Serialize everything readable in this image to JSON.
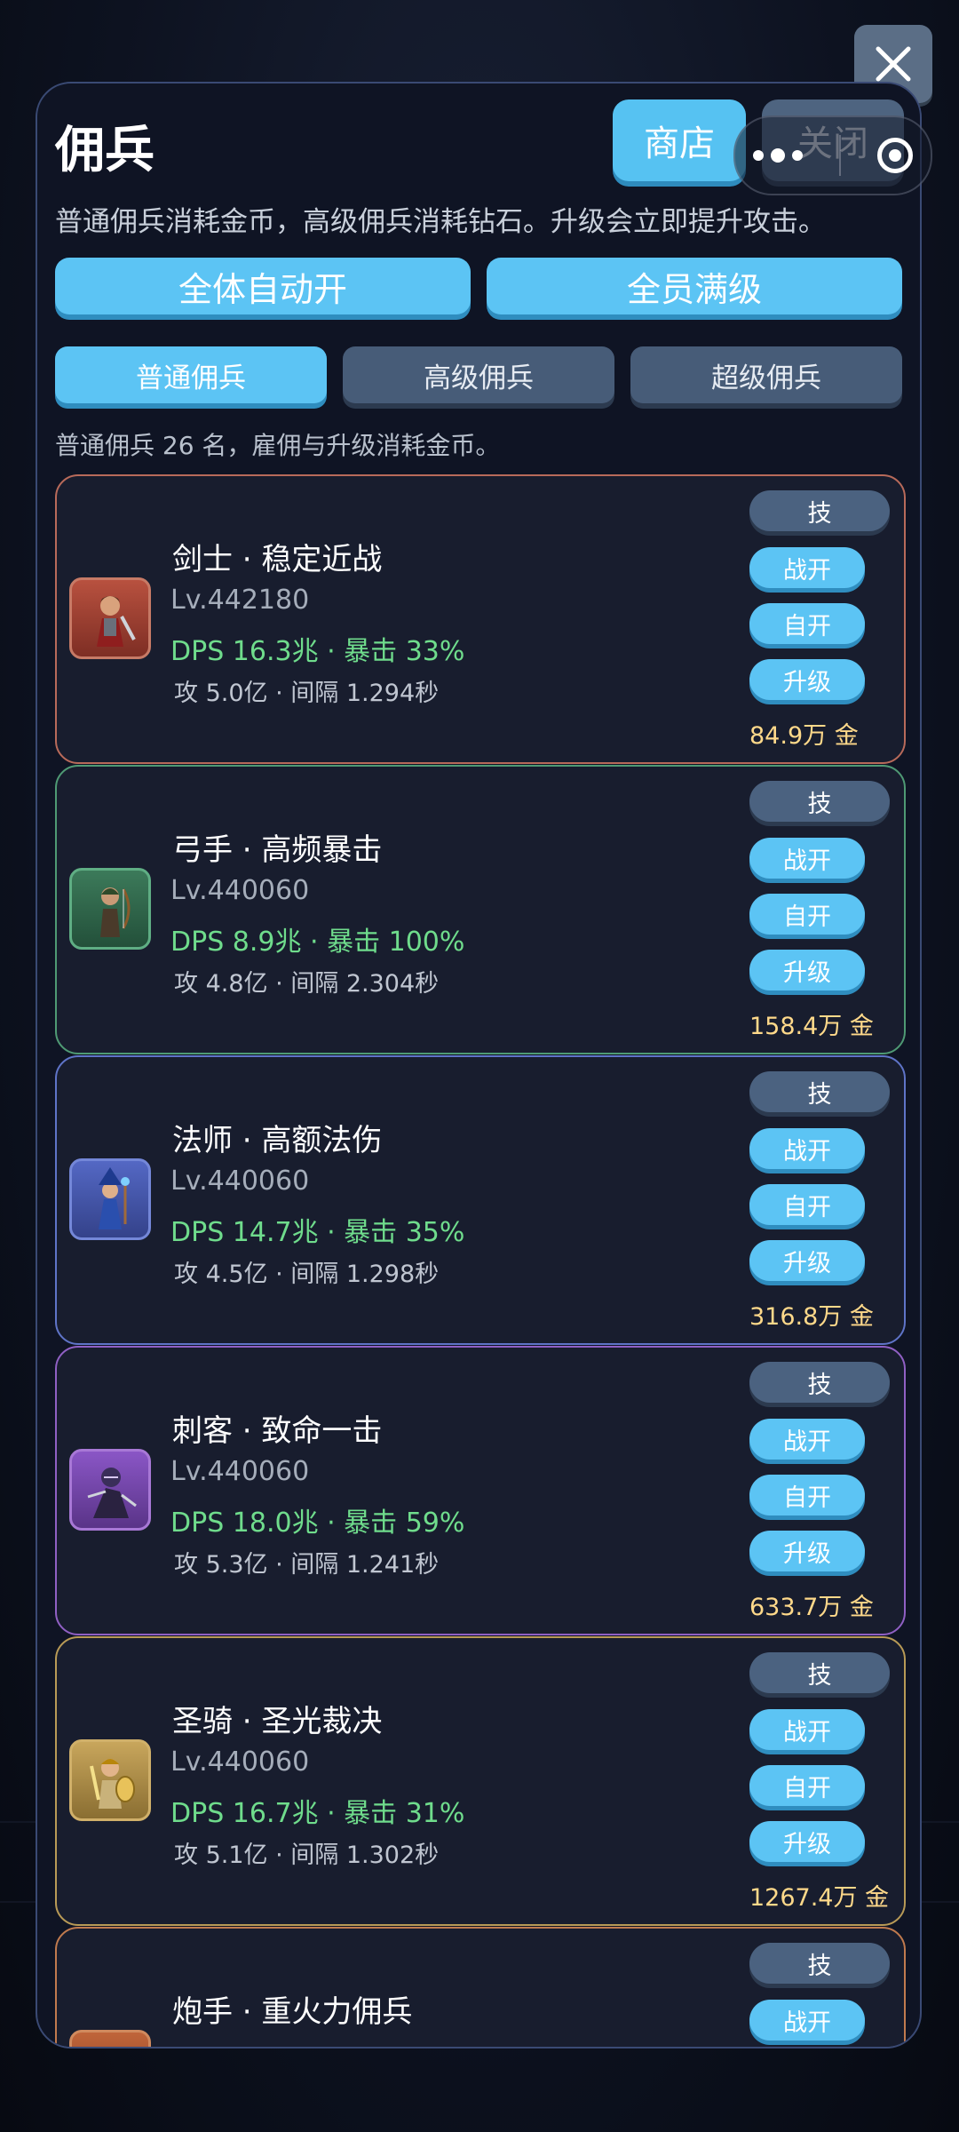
{
  "top": {
    "close_icon": "close-x-icon"
  },
  "capsule": {
    "menu_icon": "more-dots-icon",
    "exit_icon": "target-circle-icon"
  },
  "panel": {
    "title": "佣兵",
    "shop_label": "商店",
    "close_label": "关闭",
    "description": "普通佣兵消耗金币，高级佣兵消耗钻石。升级会立即提升攻击。",
    "auto_all_label": "全体自动开",
    "max_all_label": "全员满级",
    "tabs": [
      {
        "label": "普通佣兵",
        "active": true
      },
      {
        "label": "高级佣兵",
        "active": false
      },
      {
        "label": "超级佣兵",
        "active": false
      }
    ],
    "count_note": "普通佣兵 26 名，雇佣与升级消耗金币。"
  },
  "colors": {
    "accent_blue": "#5cc4f4",
    "dps_green": "#6fdc8c",
    "gold_cost": "#ffd98a"
  },
  "mercenaries": [
    {
      "name": "剑士 · 稳定近战",
      "level": "Lv.442180",
      "dps": "DPS 16.3兆 · 暴击 33%",
      "attack": "攻 5.0亿 · 间隔 1.294秒",
      "skill": "技",
      "battle": "战开",
      "auto": "自开",
      "upgrade": "升级",
      "cost": "84.9万 金",
      "border_color": "#b86a5a",
      "icon": "swordsman-icon"
    },
    {
      "name": "弓手 · 高频暴击",
      "level": "Lv.440060",
      "dps": "DPS 8.9兆 · 暴击 100%",
      "attack": "攻 4.8亿 · 间隔 2.304秒",
      "skill": "技",
      "battle": "战开",
      "auto": "自开",
      "upgrade": "升级",
      "cost": "158.4万 金",
      "border_color": "#4f9a74",
      "icon": "archer-icon"
    },
    {
      "name": "法师 · 高额法伤",
      "level": "Lv.440060",
      "dps": "DPS 14.7兆 · 暴击 35%",
      "attack": "攻 4.5亿 · 间隔 1.298秒",
      "skill": "技",
      "battle": "战开",
      "auto": "自开",
      "upgrade": "升级",
      "cost": "316.8万 金",
      "border_color": "#5f74c8",
      "icon": "mage-icon"
    },
    {
      "name": "刺客 · 致命一击",
      "level": "Lv.440060",
      "dps": "DPS 18.0兆 · 暴击 59%",
      "attack": "攻 5.3亿 · 间隔 1.241秒",
      "skill": "技",
      "battle": "战开",
      "auto": "自开",
      "upgrade": "升级",
      "cost": "633.7万 金",
      "border_color": "#9060c4",
      "icon": "assassin-icon"
    },
    {
      "name": "圣骑 · 圣光裁决",
      "level": "Lv.440060",
      "dps": "DPS 16.7兆 · 暴击 31%",
      "attack": "攻 5.1亿 · 间隔 1.302秒",
      "skill": "技",
      "battle": "战开",
      "auto": "自开",
      "upgrade": "升级",
      "cost": "1267.4万 金",
      "border_color": "#b89a56",
      "icon": "paladin-icon"
    },
    {
      "name": "炮手 · 重火力佣兵",
      "skill": "技",
      "battle": "战开",
      "border_color": "#c07a4e",
      "icon": "gunner-icon"
    }
  ]
}
